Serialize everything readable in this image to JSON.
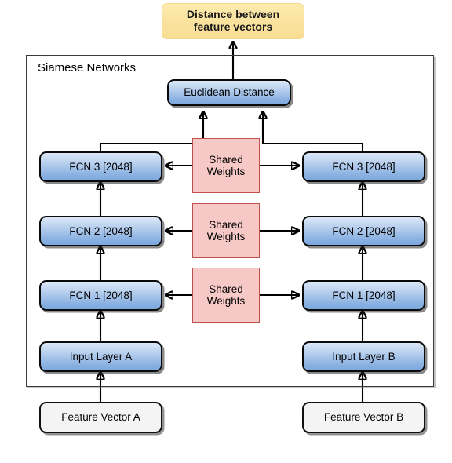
{
  "diagram": {
    "title": "Siamese Networks",
    "output": {
      "label": "Distance between\nfeature vectors",
      "color": "#fbe4a0"
    },
    "merge": {
      "label": "Euclidean Distance",
      "color": "#8fb4e3"
    },
    "branch_a": {
      "name": "A",
      "layers": [
        {
          "label": "FCN 3 [2048]"
        },
        {
          "label": "FCN 2 [2048]"
        },
        {
          "label": "FCN 1 [2048]"
        },
        {
          "label": "Input Layer A"
        }
      ],
      "source": {
        "label": "Feature Vector A"
      }
    },
    "branch_b": {
      "name": "B",
      "layers": [
        {
          "label": "FCN 3 [2048]"
        },
        {
          "label": "FCN 2 [2048]"
        },
        {
          "label": "FCN 1 [2048]"
        },
        {
          "label": "Input Layer B"
        }
      ],
      "source": {
        "label": "Feature Vector B"
      }
    },
    "shared": [
      {
        "line1": "Shared",
        "line2": "Weights"
      },
      {
        "line1": "Shared",
        "line2": "Weights"
      },
      {
        "line1": "Shared",
        "line2": "Weights"
      }
    ],
    "colors": {
      "node_blue": "#8fb4e3",
      "node_pink": "#f6c9c6",
      "node_pink_border": "#c0504d",
      "node_grey": "#f4f4f4",
      "output_yellow": "#fbe4a0",
      "stroke": "#000000"
    }
  }
}
